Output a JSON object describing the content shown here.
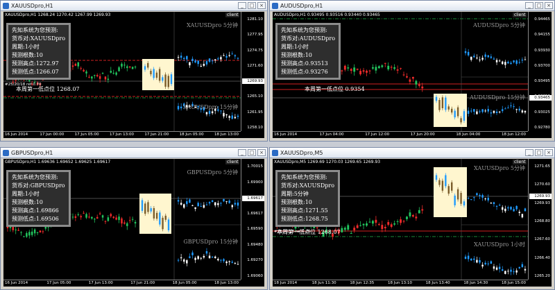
{
  "windows": [
    {
      "id": "xau-h1",
      "title": "XAUUSDpro,H1",
      "symbar": "XAUUSDpro,H1  1268.24 1270.42 1267.99 1269.93",
      "client": "client",
      "info": [
        "先知系统为您预测:",
        "货币对:XAUUSDpro",
        "周期:1小时",
        "预测根数:10",
        "预测高点:1272.97",
        "预测低点:1266.07"
      ],
      "sub_top": "XAUUSDpro 5分钟",
      "sub_bottom": "XAUUSDpro 15分钟",
      "week_label": "本周第一低点位 1268.07",
      "small_label": "#25/20/18 ref 0.70",
      "current_price": "1269.93",
      "price_ticks": [
        "1281.10",
        "1277.95",
        "1274.75",
        "1271.60",
        "1268.00",
        "1265.10",
        "1261.95",
        "1258.10"
      ],
      "time_ticks": [
        "16 Jun 2014",
        "17 Jun 00:00",
        "17 Jun 05:00",
        "17 Jun 13:00",
        "17 Jun 21:00",
        "18 Jun 05:00",
        "18 Jun 13:00"
      ]
    },
    {
      "id": "aud-h1",
      "title": "AUDUSDpro,H1",
      "symbar": "AUDUSDpro,H1  0.93495 0.93516 0.93440 0.93465",
      "client": "client",
      "info": [
        "先知系统为您预测:",
        "货币对:AUDUSDpro",
        "周期:1小时",
        "预测根数:10",
        "预测高点:0.93513",
        "预测低点:0.93276"
      ],
      "sub_top": "AUDUSDpro 5分钟",
      "sub_bottom": "AUDUSDpro 15分钟",
      "week_label": "本周第一低点位 0.9354",
      "small_label": "",
      "current_price": "0.93465",
      "price_ticks": [
        "0.94465",
        "0.94155",
        "0.93930",
        "0.93700",
        "0.93495",
        "0.93250",
        "0.93025",
        "0.92780"
      ],
      "time_ticks": [
        "16 Jun 2014",
        "17 Jun 04:00",
        "17 Jun 12:00",
        "17 Jun 20:00",
        "18 Jun 04:00",
        "18 Jun 12:00"
      ]
    },
    {
      "id": "gbp-h1",
      "title": "GBPUSDpro,H1",
      "symbar": "GBPUSDpro,H1  1.69636 1.69652 1.69625 1.69617",
      "client": "client",
      "info": [
        "先知系统为您预测:",
        "货币对:GBPUSDpro",
        "周期:1小时",
        "预测根数:10",
        "预测高点:1.69866",
        "预测低点:1.69506"
      ],
      "sub_top": "GBPUSDpro 5分钟",
      "sub_bottom": "GBPUSDpro 15分钟",
      "week_label": "",
      "small_label": "",
      "current_price": "1.69617",
      "price_ticks": [
        "1.70015",
        "1.69900",
        "1.69800",
        "1.69617",
        "1.69590",
        "1.69480",
        "1.69270",
        "1.69060"
      ],
      "time_ticks": [
        "16 Jun 2014",
        "17 Jun 05:00",
        "17 Jun 13:00",
        "17 Jun 21:00",
        "18 Jun 05:00",
        "18 Jun 13:00"
      ]
    },
    {
      "id": "xau-m5",
      "title": "XAUUSDpro,M5",
      "symbar": "XAUUSDpro,M5  1269.69 1270.03 1269.65 1269.93",
      "client": "client",
      "info": [
        "先知系统为您预测:",
        "货币对:XAUUSDpro",
        "周期:5分钟",
        "预测根数:10",
        "预测高点:1271.55",
        "预测低点:1268.75"
      ],
      "sub_top": "XAUUSDpro 5分钟",
      "sub_bottom": "XAUUSDpro 1小时",
      "week_label": "本周第一低点位 1268.07",
      "small_label": "#25/20/18 ref 0.20",
      "current_price": "1269.93",
      "price_ticks": [
        "1271.65",
        "1270.60",
        "1269.93",
        "1268.80",
        "1267.60",
        "1266.40",
        "1265.20"
      ],
      "time_ticks": [
        "18 Jun 2014",
        "18 Jun 11:30",
        "18 Jun 12:35",
        "18 Jun 13:10",
        "18 Jun 13:40",
        "18 Jun 14:30",
        "18 Jun 15:00"
      ]
    }
  ]
}
